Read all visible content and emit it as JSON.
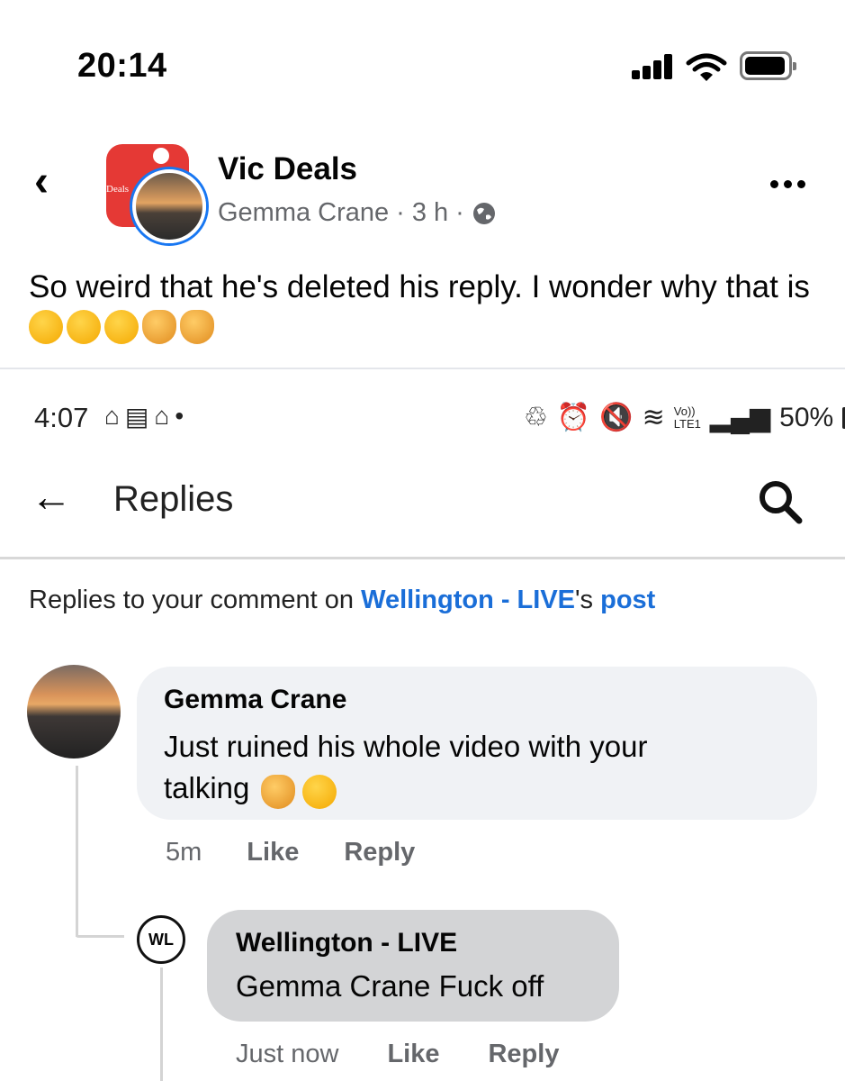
{
  "ios_status": {
    "time": "20:14"
  },
  "post": {
    "group_name": "Vic Deals",
    "author": "Gemma Crane",
    "age": "3 h",
    "separator": "·",
    "text": "So weird that he's deleted his reply. I wonder why that is",
    "emojis": [
      "thinking-face",
      "thinking-face",
      "thinking-face",
      "woman-facepalming",
      "woman-facepalming"
    ]
  },
  "android_status": {
    "time": "4:07",
    "battery": "50%",
    "network": "Vo)) LTE1"
  },
  "replies_screen": {
    "title": "Replies",
    "context_prefix": "Replies to your comment on ",
    "context_link": "Wellington - LIVE",
    "context_mid": "'s ",
    "context_post": "post"
  },
  "comment": {
    "author": "Gemma Crane",
    "text": "Just ruined his whole video with your talking",
    "time": "5m",
    "like": "Like",
    "reply": "Reply"
  },
  "reply": {
    "avatar_initials": "WL",
    "author": "Wellington - LIVE",
    "text": "Gemma Crane Fuck off",
    "time": "Just now",
    "like": "Like",
    "reply": "Reply"
  }
}
